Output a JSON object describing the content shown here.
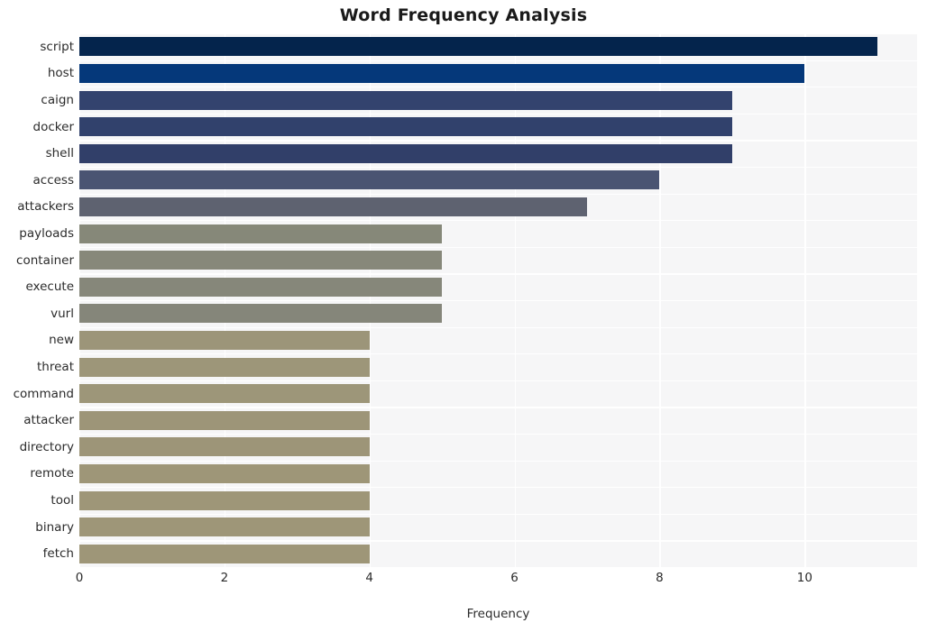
{
  "chart_data": {
    "type": "bar",
    "orientation": "horizontal",
    "title": "Word Frequency Analysis",
    "xlabel": "Frequency",
    "ylabel": "",
    "xlim": [
      0,
      11.55
    ],
    "xticks": [
      0,
      2,
      4,
      6,
      8,
      10
    ],
    "xtick_labels": [
      "0",
      "2",
      "4",
      "6",
      "8",
      "10"
    ],
    "grid": true,
    "legend": null,
    "categories": [
      "script",
      "host",
      "caign",
      "docker",
      "shell",
      "access",
      "attackers",
      "payloads",
      "container",
      "execute",
      "vurl",
      "new",
      "threat",
      "command",
      "attacker",
      "directory",
      "remote",
      "tool",
      "binary",
      "fetch"
    ],
    "values": [
      11,
      10,
      9,
      9,
      9,
      8,
      7,
      5,
      5,
      5,
      5,
      4,
      4,
      4,
      4,
      4,
      4,
      4,
      4,
      4
    ],
    "bar_colors": [
      "#04244c",
      "#05387a",
      "#33436e",
      "#31416c",
      "#313f69",
      "#4a5472",
      "#5e6270",
      "#868879",
      "#87887a",
      "#86877a",
      "#85867a",
      "#9c9579",
      "#9d9679",
      "#9d9679",
      "#9d9578",
      "#9d9578",
      "#9e9678",
      "#9e9678",
      "#9e9678",
      "#9e9678"
    ],
    "plot_background": "#f6f6f7",
    "grid_color": "#ffffff",
    "text_color": "#2b2b2b",
    "title_color": "#1a1a1a"
  }
}
